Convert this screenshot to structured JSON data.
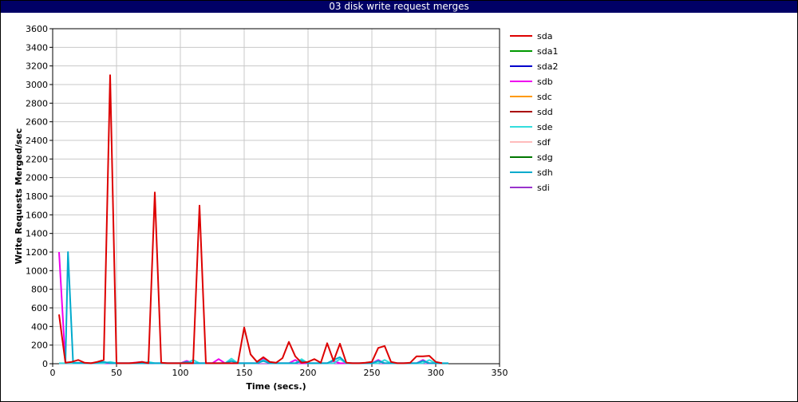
{
  "window": {
    "title": "03 disk write request merges"
  },
  "chart_data": {
    "type": "line",
    "title": "03 disk write request merges",
    "xlabel": "Time (secs.)",
    "ylabel": "Write Requests Merged/sec",
    "xlim": [
      0,
      350
    ],
    "ylim": [
      0,
      3600
    ],
    "xticks": [
      0,
      50,
      100,
      150,
      200,
      250,
      300,
      350
    ],
    "yticks": [
      0,
      200,
      400,
      600,
      800,
      1000,
      1200,
      1400,
      1600,
      1800,
      2000,
      2200,
      2400,
      2600,
      2800,
      3000,
      3200,
      3400,
      3600
    ],
    "grid": true,
    "legend_position": "right",
    "series": [
      {
        "name": "sda",
        "color": "#dd0000",
        "width": 2,
        "points": [
          [
            5,
            530
          ],
          [
            10,
            10
          ],
          [
            15,
            20
          ],
          [
            20,
            40
          ],
          [
            25,
            10
          ],
          [
            30,
            5
          ],
          [
            35,
            20
          ],
          [
            40,
            40
          ],
          [
            45,
            3100
          ],
          [
            50,
            5
          ],
          [
            55,
            5
          ],
          [
            60,
            5
          ],
          [
            65,
            10
          ],
          [
            70,
            20
          ],
          [
            75,
            5
          ],
          [
            80,
            1840
          ],
          [
            85,
            10
          ],
          [
            90,
            5
          ],
          [
            95,
            5
          ],
          [
            100,
            5
          ],
          [
            105,
            5
          ],
          [
            110,
            5
          ],
          [
            115,
            1700
          ],
          [
            120,
            5
          ],
          [
            125,
            5
          ],
          [
            130,
            5
          ],
          [
            135,
            5
          ],
          [
            140,
            5
          ],
          [
            145,
            5
          ],
          [
            150,
            390
          ],
          [
            155,
            100
          ],
          [
            160,
            20
          ],
          [
            165,
            70
          ],
          [
            170,
            20
          ],
          [
            175,
            10
          ],
          [
            180,
            60
          ],
          [
            185,
            235
          ],
          [
            190,
            80
          ],
          [
            195,
            10
          ],
          [
            200,
            20
          ],
          [
            205,
            50
          ],
          [
            210,
            10
          ],
          [
            215,
            220
          ],
          [
            220,
            30
          ],
          [
            225,
            215
          ],
          [
            230,
            10
          ],
          [
            235,
            5
          ],
          [
            240,
            5
          ],
          [
            245,
            10
          ],
          [
            250,
            20
          ],
          [
            255,
            170
          ],
          [
            260,
            190
          ],
          [
            265,
            20
          ],
          [
            270,
            5
          ],
          [
            275,
            5
          ],
          [
            280,
            10
          ],
          [
            285,
            80
          ],
          [
            290,
            80
          ],
          [
            295,
            85
          ],
          [
            300,
            20
          ],
          [
            305,
            5
          ]
        ]
      },
      {
        "name": "sda1",
        "color": "#009900",
        "width": 1,
        "points": [
          [
            5,
            0
          ],
          [
            50,
            0
          ],
          [
            100,
            0
          ],
          [
            150,
            0
          ],
          [
            200,
            0
          ],
          [
            250,
            0
          ],
          [
            305,
            0
          ]
        ]
      },
      {
        "name": "sda2",
        "color": "#0000cc",
        "width": 1,
        "points": [
          [
            5,
            0
          ],
          [
            50,
            0
          ],
          [
            100,
            0
          ],
          [
            150,
            0
          ],
          [
            200,
            0
          ],
          [
            250,
            0
          ],
          [
            305,
            0
          ]
        ]
      },
      {
        "name": "sdb",
        "color": "#ee00ee",
        "width": 2,
        "points": [
          [
            5,
            1200
          ],
          [
            10,
            10
          ],
          [
            20,
            5
          ],
          [
            40,
            5
          ],
          [
            60,
            5
          ],
          [
            70,
            20
          ],
          [
            75,
            5
          ],
          [
            100,
            5
          ],
          [
            105,
            30
          ],
          [
            110,
            5
          ],
          [
            125,
            5
          ],
          [
            130,
            50
          ],
          [
            135,
            5
          ],
          [
            160,
            5
          ],
          [
            165,
            60
          ],
          [
            170,
            5
          ],
          [
            185,
            5
          ],
          [
            190,
            40
          ],
          [
            195,
            5
          ],
          [
            215,
            5
          ],
          [
            220,
            30
          ],
          [
            225,
            5
          ],
          [
            250,
            5
          ],
          [
            255,
            40
          ],
          [
            260,
            5
          ],
          [
            285,
            5
          ],
          [
            290,
            40
          ],
          [
            295,
            5
          ],
          [
            305,
            5
          ]
        ]
      },
      {
        "name": "sdc",
        "color": "#ff9900",
        "width": 1,
        "points": [
          [
            5,
            0
          ],
          [
            50,
            0
          ],
          [
            100,
            0
          ],
          [
            150,
            0
          ],
          [
            200,
            0
          ],
          [
            250,
            0
          ],
          [
            305,
            0
          ]
        ]
      },
      {
        "name": "sdd",
        "color": "#aa0000",
        "width": 1,
        "points": [
          [
            5,
            0
          ],
          [
            50,
            0
          ],
          [
            100,
            0
          ],
          [
            150,
            0
          ],
          [
            200,
            0
          ],
          [
            250,
            0
          ],
          [
            305,
            0
          ]
        ]
      },
      {
        "name": "sde",
        "color": "#33dddd",
        "width": 2,
        "points": [
          [
            5,
            5
          ],
          [
            40,
            5
          ],
          [
            45,
            20
          ],
          [
            50,
            5
          ],
          [
            70,
            5
          ],
          [
            75,
            20
          ],
          [
            80,
            5
          ],
          [
            105,
            5
          ],
          [
            110,
            40
          ],
          [
            115,
            5
          ],
          [
            135,
            5
          ],
          [
            140,
            55
          ],
          [
            145,
            5
          ],
          [
            160,
            5
          ],
          [
            165,
            40
          ],
          [
            170,
            5
          ],
          [
            190,
            5
          ],
          [
            195,
            50
          ],
          [
            200,
            5
          ],
          [
            220,
            5
          ],
          [
            225,
            50
          ],
          [
            230,
            5
          ],
          [
            255,
            5
          ],
          [
            260,
            40
          ],
          [
            265,
            5
          ],
          [
            290,
            5
          ],
          [
            295,
            40
          ],
          [
            300,
            5
          ],
          [
            305,
            5
          ]
        ]
      },
      {
        "name": "sdf",
        "color": "#ffbbbb",
        "width": 1,
        "points": [
          [
            5,
            0
          ],
          [
            50,
            0
          ],
          [
            100,
            0
          ],
          [
            150,
            0
          ],
          [
            200,
            0
          ],
          [
            250,
            0
          ],
          [
            305,
            0
          ]
        ]
      },
      {
        "name": "sdg",
        "color": "#007700",
        "width": 1,
        "points": [
          [
            5,
            0
          ],
          [
            50,
            0
          ],
          [
            100,
            0
          ],
          [
            150,
            0
          ],
          [
            200,
            0
          ],
          [
            250,
            0
          ],
          [
            305,
            0
          ]
        ]
      },
      {
        "name": "sdh",
        "color": "#00aacc",
        "width": 2,
        "points": [
          [
            10,
            5
          ],
          [
            12,
            1200
          ],
          [
            16,
            10
          ],
          [
            30,
            5
          ],
          [
            40,
            20
          ],
          [
            45,
            5
          ],
          [
            80,
            5
          ],
          [
            100,
            5
          ],
          [
            105,
            20
          ],
          [
            110,
            5
          ],
          [
            135,
            5
          ],
          [
            140,
            30
          ],
          [
            145,
            5
          ],
          [
            160,
            5
          ],
          [
            165,
            30
          ],
          [
            170,
            5
          ],
          [
            190,
            5
          ],
          [
            195,
            30
          ],
          [
            200,
            5
          ],
          [
            215,
            5
          ],
          [
            220,
            40
          ],
          [
            225,
            70
          ],
          [
            230,
            5
          ],
          [
            250,
            5
          ],
          [
            255,
            30
          ],
          [
            260,
            5
          ],
          [
            285,
            5
          ],
          [
            290,
            30
          ],
          [
            295,
            5
          ],
          [
            305,
            5
          ],
          [
            310,
            5
          ]
        ]
      },
      {
        "name": "sdi",
        "color": "#9933cc",
        "width": 1,
        "points": [
          [
            5,
            0
          ],
          [
            50,
            0
          ],
          [
            100,
            0
          ],
          [
            150,
            0
          ],
          [
            200,
            0
          ],
          [
            250,
            0
          ],
          [
            305,
            0
          ]
        ]
      }
    ]
  }
}
